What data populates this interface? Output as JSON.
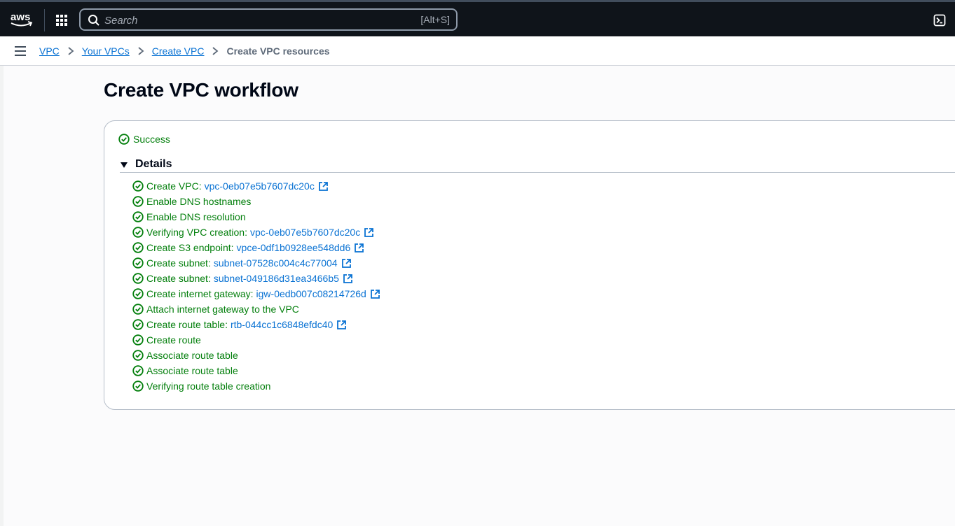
{
  "topbar": {
    "logo": "aws",
    "apps_icon": "apps-grid-icon",
    "search_placeholder": "Search",
    "search_shortcut": "[Alt+S]",
    "cloudshell_icon": "cloudshell-icon"
  },
  "breadcrumb": {
    "items": [
      {
        "label": "VPC",
        "link": true
      },
      {
        "label": "Your VPCs",
        "link": true
      },
      {
        "label": "Create VPC",
        "link": true
      },
      {
        "label": "Create VPC resources",
        "link": false
      }
    ]
  },
  "page": {
    "title": "Create VPC workflow"
  },
  "workflow": {
    "status": "Success",
    "details_label": "Details",
    "steps": [
      {
        "label": "Create VPC:",
        "resource": "vpc-0eb07e5b7607dc20c"
      },
      {
        "label": "Enable DNS hostnames",
        "resource": ""
      },
      {
        "label": "Enable DNS resolution",
        "resource": ""
      },
      {
        "label": "Verifying VPC creation:",
        "resource": "vpc-0eb07e5b7607dc20c"
      },
      {
        "label": "Create S3 endpoint:",
        "resource": "vpce-0df1b0928ee548dd6"
      },
      {
        "label": "Create subnet:",
        "resource": "subnet-07528c004c4c77004"
      },
      {
        "label": "Create subnet:",
        "resource": "subnet-049186d31ea3466b5"
      },
      {
        "label": "Create internet gateway:",
        "resource": "igw-0edb007c08214726d"
      },
      {
        "label": "Attach internet gateway to the VPC",
        "resource": ""
      },
      {
        "label": "Create route table:",
        "resource": "rtb-044cc1c6848efdc40"
      },
      {
        "label": "Create route",
        "resource": ""
      },
      {
        "label": "Associate route table",
        "resource": ""
      },
      {
        "label": "Associate route table",
        "resource": ""
      },
      {
        "label": "Verifying route table creation",
        "resource": ""
      }
    ]
  },
  "colors": {
    "topbar_bg": "#0f141a",
    "link": "#0972d3",
    "success": "#037f0c"
  }
}
